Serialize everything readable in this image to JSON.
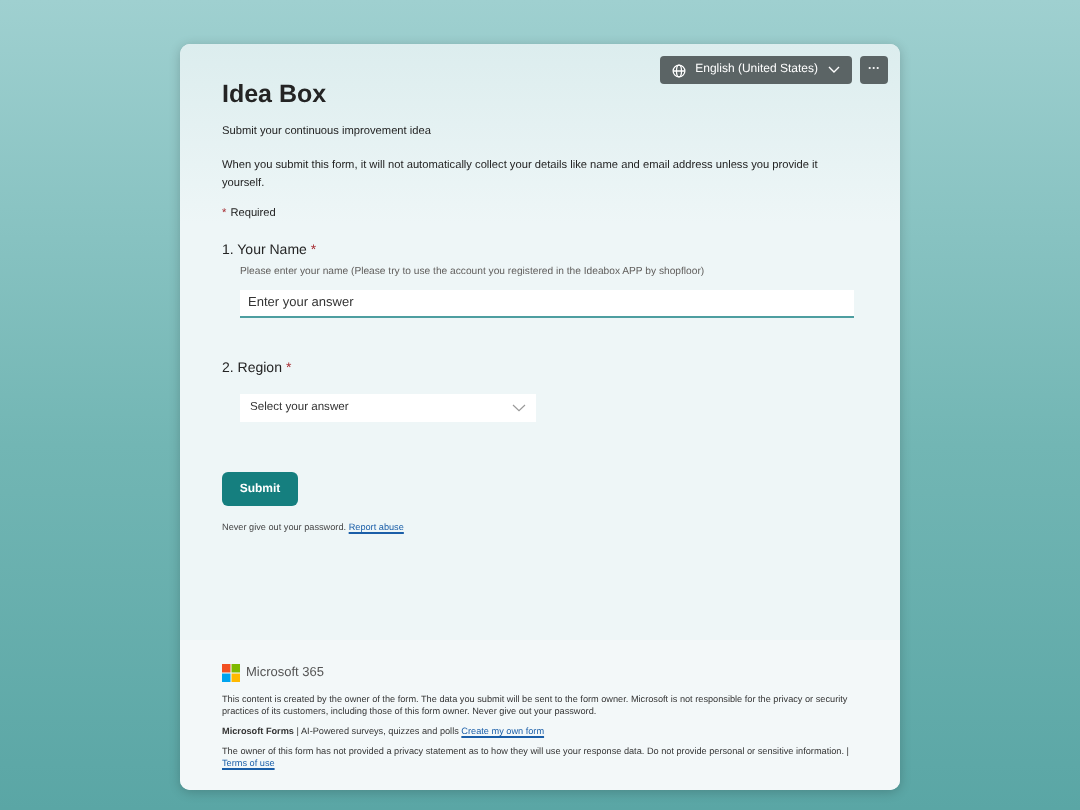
{
  "header": {
    "language": "English (United States)",
    "more": "···"
  },
  "form": {
    "title": "Idea Box",
    "subtitle": "Submit your continuous improvement idea",
    "notice": "When you submit this form, it will not automatically collect your details like name and email address unless you provide it yourself.",
    "required_mark": "*",
    "required_note": "Required"
  },
  "questions": [
    {
      "number": "1.",
      "label": "Your Name",
      "required": true,
      "required_mark": "*",
      "description": "Please enter your name (Please try to use the account you registered in the Ideabox APP by shopfloor)",
      "kind": "text",
      "placeholder": "Enter your answer"
    },
    {
      "number": "2.",
      "label": "Region",
      "required": true,
      "required_mark": "*",
      "kind": "select",
      "placeholder": "Select your answer"
    }
  ],
  "submit": "Submit",
  "password_note": "Never give out your password.",
  "report_link": "Report abuse",
  "footer": {
    "brand": "Microsoft 365",
    "disclaimer": "This content is created by the owner of the form. The data you submit will be sent to the form owner. Microsoft is not responsible for the privacy or security practices of its customers, including those of this form owner. Never give out your password.",
    "forms_line": "**Microsoft Forms** | AI-Powered surveys, quizzes and polls",
    "create_link": "Create my own form",
    "privacy": "The owner of this form has not provided a privacy statement as to how they will use your response data. Do not provide personal or sensitive information. |",
    "terms_link": "Terms of use"
  }
}
